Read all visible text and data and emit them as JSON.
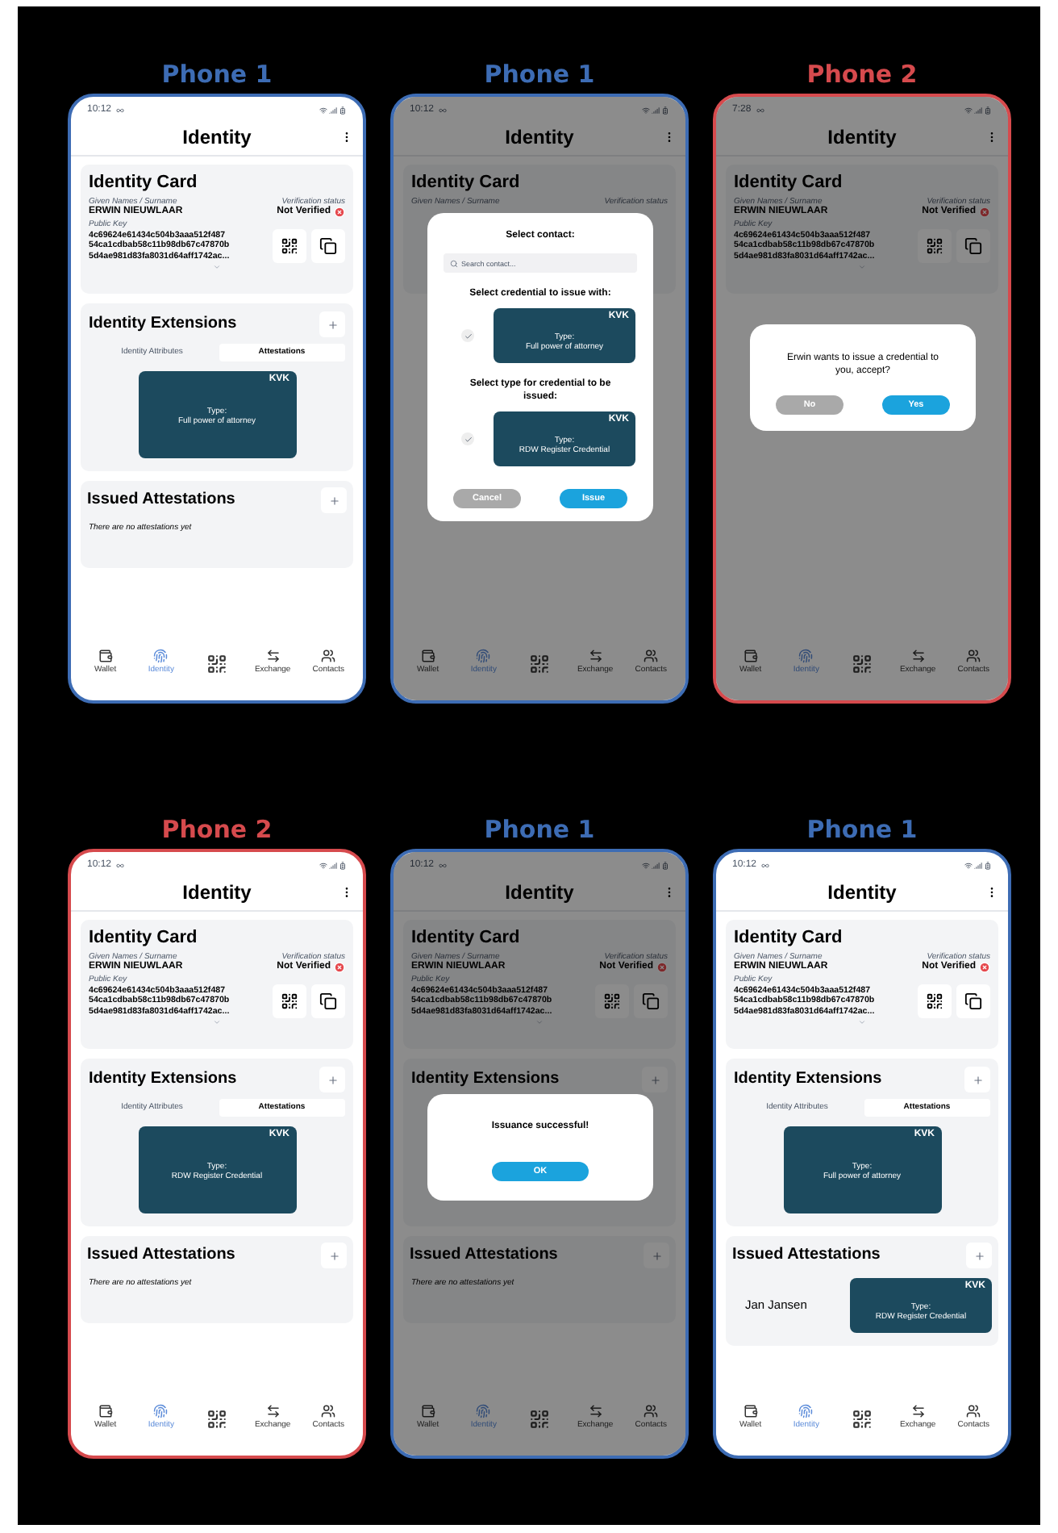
{
  "phones": [
    {
      "label": "Phone 1",
      "color": "#3d6cb4",
      "time": "10:12",
      "title": "Identity",
      "card": {
        "title": "Identity Card",
        "name_label": "Given Names / Surname",
        "name": "ERWIN NIEUWLAAR",
        "status_label": "Verification status",
        "status": "Not Verified",
        "key_label": "Public Key",
        "key_lines": [
          "4c69624e61434c504b3aaa512f487",
          "54ca1cdbab58c11b98db67c47870b",
          "5d4ae981d83fa8031d64aff1742ac..."
        ]
      },
      "extensions": {
        "title": "Identity Extensions",
        "tabs": [
          {
            "label": "Identity Attributes",
            "selected": false
          },
          {
            "label": "Attestations",
            "selected": true
          }
        ],
        "credential": {
          "issuer": "KVK",
          "type_label": "Type:",
          "type": "Full power of attorney"
        }
      },
      "issued": {
        "title": "Issued Attestations",
        "empty_text": "There are no attestations yet"
      },
      "nav": [
        {
          "label": "Wallet",
          "selected": false
        },
        {
          "label": "Identity",
          "selected": true
        },
        {
          "selected": false
        },
        {
          "label": "Exchange",
          "selected": false
        },
        {
          "label": "Contacts",
          "selected": false
        }
      ]
    },
    {
      "label": "Phone 1",
      "color": "#3d6cb4",
      "time": "10:12",
      "title": "Identity",
      "card": {
        "title": "Identity Card",
        "name_label": "Given Names / Surname",
        "status_label": "Verification status"
      },
      "nav": [
        {
          "label": "Wallet",
          "selected": false
        },
        {
          "label": "Identity",
          "selected": true
        },
        {
          "selected": false
        },
        {
          "label": "Exchange",
          "selected": false
        },
        {
          "label": "Contacts",
          "selected": false
        }
      ],
      "dialog": {
        "kind": "issue",
        "title": "Select contact:",
        "search_placeholder": "Search contact...",
        "groups": [
          {
            "heading": "Select credential to issue with:",
            "checked": true,
            "credential": {
              "issuer": "KVK",
              "type_label": "Type:",
              "type": "Full power of attorney"
            }
          },
          {
            "heading": "Select type for credential to be issued:",
            "checked": true,
            "credential": {
              "issuer": "KVK",
              "type_label": "Type:",
              "type": "RDW Register Credential"
            }
          }
        ],
        "buttons": [
          {
            "label": "Cancel",
            "kind": "secondary"
          },
          {
            "label": "Issue",
            "kind": "primary"
          }
        ]
      }
    },
    {
      "label": "Phone 2",
      "color": "#d64a4d",
      "time": "7:28",
      "title": "Identity",
      "card": {
        "title": "Identity Card",
        "name_label": "Given Names / Surname",
        "name": "ERWIN NIEUWLAAR",
        "status_label": "Verification status",
        "status": "Not Verified",
        "key_label": "Public Key",
        "key_lines": [
          "4c69624e61434c504b3aaa512f487",
          "54ca1cdbab58c11b98db67c47870b",
          "5d4ae981d83fa8031d64aff1742ac..."
        ]
      },
      "nav": [
        {
          "label": "Wallet",
          "selected": false
        },
        {
          "label": "Identity",
          "selected": true
        },
        {
          "selected": false
        },
        {
          "label": "Exchange",
          "selected": false
        },
        {
          "label": "Contacts",
          "selected": false
        }
      ],
      "dialog": {
        "kind": "confirm",
        "message": "Erwin wants to issue a credential to you, accept?",
        "buttons": [
          {
            "label": "No",
            "kind": "secondary"
          },
          {
            "label": "Yes",
            "kind": "primary"
          }
        ]
      }
    },
    {
      "label": "Phone 2",
      "color": "#d64a4d",
      "time": "10:12",
      "title": "Identity",
      "card": {
        "title": "Identity Card",
        "name_label": "Given Names / Surname",
        "name": "ERWIN NIEUWLAAR",
        "status_label": "Verification status",
        "status": "Not Verified",
        "key_label": "Public Key",
        "key_lines": [
          "4c69624e61434c504b3aaa512f487",
          "54ca1cdbab58c11b98db67c47870b",
          "5d4ae981d83fa8031d64aff1742ac..."
        ]
      },
      "extensions": {
        "title": "Identity Extensions",
        "tabs": [
          {
            "label": "Identity Attributes",
            "selected": false
          },
          {
            "label": "Attestations",
            "selected": true
          }
        ],
        "credential": {
          "issuer": "KVK",
          "type_label": "Type:",
          "type": "RDW Register Credential"
        }
      },
      "issued": {
        "title": "Issued Attestations",
        "empty_text": "There are no attestations yet"
      },
      "nav": [
        {
          "label": "Wallet",
          "selected": false
        },
        {
          "label": "Identity",
          "selected": true
        },
        {
          "selected": false
        },
        {
          "label": "Exchange",
          "selected": false
        },
        {
          "label": "Contacts",
          "selected": false
        }
      ]
    },
    {
      "label": "Phone 1",
      "color": "#3d6cb4",
      "time": "10:12",
      "title": "Identity",
      "card": {
        "title": "Identity Card",
        "name_label": "Given Names / Surname",
        "name": "ERWIN NIEUWLAAR",
        "status_label": "Verification status",
        "status": "Not Verified",
        "key_label": "Public Key",
        "key_lines": [
          "4c69624e61434c504b3aaa512f487",
          "54ca1cdbab58c11b98db67c47870b",
          "5d4ae981d83fa8031d64aff1742ac..."
        ]
      },
      "extensions": {
        "title": "Identity Extensions"
      },
      "issued": {
        "title": "Issued Attestations",
        "empty_text": "There are no attestations yet"
      },
      "nav": [
        {
          "label": "Wallet",
          "selected": false
        },
        {
          "label": "Identity",
          "selected": true
        },
        {
          "selected": false
        },
        {
          "label": "Exchange",
          "selected": false
        },
        {
          "label": "Contacts",
          "selected": false
        }
      ],
      "dialog": {
        "kind": "success",
        "message": "Issuance successful!",
        "buttons": [
          {
            "label": "OK",
            "kind": "primary"
          }
        ]
      }
    },
    {
      "label": "Phone 1",
      "color": "#3d6cb4",
      "time": "10:12",
      "title": "Identity",
      "card": {
        "title": "Identity Card",
        "name_label": "Given Names / Surname",
        "name": "ERWIN NIEUWLAAR",
        "status_label": "Verification status",
        "status": "Not Verified",
        "key_label": "Public Key",
        "key_lines": [
          "4c69624e61434c504b3aaa512f487",
          "54ca1cdbab58c11b98db67c47870b",
          "5d4ae981d83fa8031d64aff1742ac..."
        ]
      },
      "extensions": {
        "title": "Identity Extensions",
        "tabs": [
          {
            "label": "Identity Attributes",
            "selected": false
          },
          {
            "label": "Attestations",
            "selected": true
          }
        ],
        "credential": {
          "issuer": "KVK",
          "type_label": "Type:",
          "type": "Full power of attorney"
        }
      },
      "issued": {
        "title": "Issued Attestations",
        "rows": [
          {
            "name": "Jan Jansen",
            "credential": {
              "issuer": "KVK",
              "type_label": "Type:",
              "type": "RDW Register Credential"
            }
          }
        ]
      },
      "nav": [
        {
          "label": "Wallet",
          "selected": false
        },
        {
          "label": "Identity",
          "selected": true
        },
        {
          "selected": false
        },
        {
          "label": "Exchange",
          "selected": false
        },
        {
          "label": "Contacts",
          "selected": false
        }
      ]
    }
  ]
}
